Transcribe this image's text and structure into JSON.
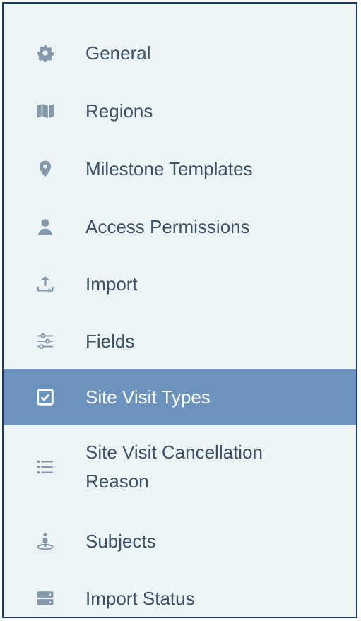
{
  "menu": {
    "items": [
      {
        "label": "General",
        "icon": "gear-icon"
      },
      {
        "label": "Regions",
        "icon": "map-icon"
      },
      {
        "label": "Milestone Templates",
        "icon": "map-pin-icon"
      },
      {
        "label": "Access Permissions",
        "icon": "user-icon"
      },
      {
        "label": "Import",
        "icon": "upload-icon"
      },
      {
        "label": "Fields",
        "icon": "sliders-icon"
      },
      {
        "label": "Site Visit Types",
        "icon": "checkbox-icon",
        "active": true
      },
      {
        "label": "Site Visit Cancellation Reason",
        "icon": "list-icon"
      },
      {
        "label": "Subjects",
        "icon": "person-location-icon"
      },
      {
        "label": "Import Status",
        "icon": "server-icon"
      }
    ]
  },
  "colors": {
    "background": "#edf4f5",
    "border": "#16386e",
    "active_background": "#6b93bd",
    "text": "#3d5267",
    "icon": "#8497ab",
    "active_text": "#ffffff"
  }
}
